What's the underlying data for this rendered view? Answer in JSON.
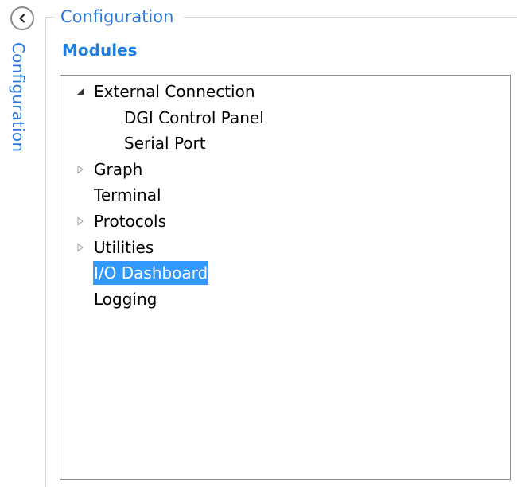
{
  "sidebar": {
    "collapse_icon": "chevron-left-icon",
    "vertical_label": "Configuration"
  },
  "group": {
    "title": "Configuration"
  },
  "modules": {
    "heading": "Modules"
  },
  "tree": {
    "items": [
      {
        "label": "External Connection",
        "level": 0,
        "expander": "expanded",
        "selected": false
      },
      {
        "label": "DGI Control Panel",
        "level": 1,
        "expander": "none",
        "selected": false
      },
      {
        "label": "Serial Port",
        "level": 1,
        "expander": "none",
        "selected": false
      },
      {
        "label": "Graph",
        "level": 0,
        "expander": "collapsed",
        "selected": false
      },
      {
        "label": "Terminal",
        "level": 0,
        "expander": "none",
        "selected": false
      },
      {
        "label": "Protocols",
        "level": 0,
        "expander": "collapsed",
        "selected": false
      },
      {
        "label": "Utilities",
        "level": 0,
        "expander": "collapsed",
        "selected": false
      },
      {
        "label": "I/O Dashboard",
        "level": 0,
        "expander": "none",
        "selected": true
      },
      {
        "label": "Logging",
        "level": 0,
        "expander": "none",
        "selected": false
      }
    ]
  },
  "colors": {
    "accent": "#2b77d8",
    "heading": "#1e7fe0",
    "selection": "#3399ff"
  }
}
